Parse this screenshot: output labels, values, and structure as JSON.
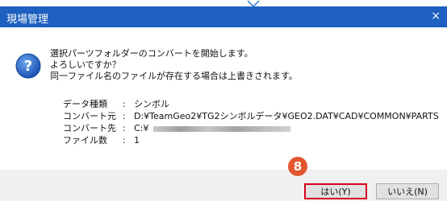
{
  "window": {
    "title": "現場管理",
    "close_glyph": "×"
  },
  "message": {
    "line1": "選択パーツフォルダーのコンバートを開始します。",
    "line2": "よろしいですか？",
    "line3": "同一ファイル名のファイルが存在する場合は上書きされます。"
  },
  "info": {
    "rows": [
      {
        "key": "データ種類",
        "sep": ":",
        "value": "シンボル"
      },
      {
        "key": "コンバート元",
        "sep": ":",
        "value": "D:¥TeamGeo2¥TG2シンボルデータ¥GEO2.DAT¥CAD¥COMMON¥PARTS"
      },
      {
        "key": "コンバート先",
        "sep": ":",
        "value": "C:¥"
      },
      {
        "key": "ファイル数",
        "sep": ":",
        "value": "1"
      }
    ]
  },
  "buttons": {
    "yes": "はい(Y)",
    "no": "いいえ(N)"
  },
  "step_badge": "8",
  "icons": {
    "dialog": "question-icon"
  },
  "colors": {
    "titlebar": "#1d60bf",
    "highlight": "#d6001c",
    "badge": "#e4572e"
  }
}
